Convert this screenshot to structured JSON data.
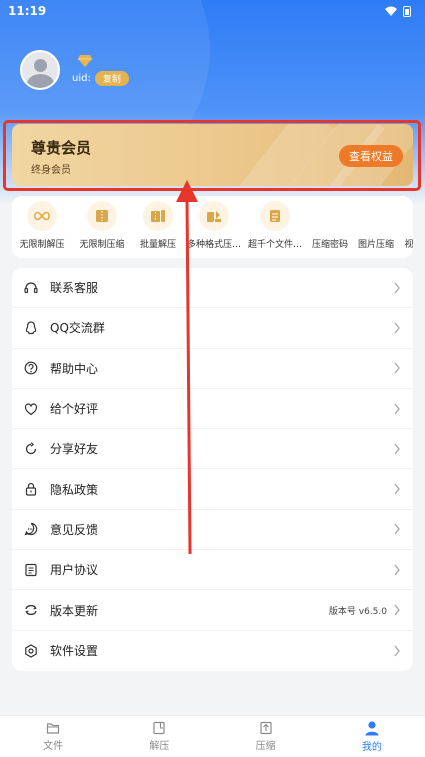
{
  "status_bar": {
    "time": "11:19"
  },
  "profile": {
    "uid_label": "uid:",
    "copy_label": "复制"
  },
  "member_card": {
    "title": "尊贵会员",
    "subtitle": "终身会员",
    "button": "查看权益"
  },
  "features": [
    {
      "label": "无限制解压",
      "icon": "infinity-icon"
    },
    {
      "label": "无限制压缩",
      "icon": "archive-icon"
    },
    {
      "label": "批量解压",
      "icon": "batch-icon"
    },
    {
      "label": "多种格式压…",
      "icon": "formats-icon"
    },
    {
      "label": "超千个文件…",
      "icon": "files-icon"
    },
    {
      "label": "压缩密码",
      "icon": ""
    },
    {
      "label": "图片压缩",
      "icon": ""
    },
    {
      "label": "视频压",
      "icon": ""
    }
  ],
  "menu": {
    "items": [
      {
        "label": "联系客服",
        "icon": "headset-icon"
      },
      {
        "label": "QQ交流群",
        "icon": "qq-icon"
      },
      {
        "label": "帮助中心",
        "icon": "help-icon"
      },
      {
        "label": "给个好评",
        "icon": "rate-icon"
      },
      {
        "label": "分享好友",
        "icon": "share-icon"
      },
      {
        "label": "隐私政策",
        "icon": "lock-icon"
      },
      {
        "label": "意见反馈",
        "icon": "feedback-icon"
      },
      {
        "label": "用户协议",
        "icon": "document-icon"
      },
      {
        "label": "版本更新",
        "icon": "refresh-icon",
        "extra": "版本号 v6.5.0"
      },
      {
        "label": "软件设置",
        "icon": "settings-icon"
      }
    ]
  },
  "tabbar": {
    "tabs": [
      {
        "label": "文件",
        "icon": "folder-icon"
      },
      {
        "label": "解压",
        "icon": "unzip-icon"
      },
      {
        "label": "压缩",
        "icon": "zip-icon"
      },
      {
        "label": "我的",
        "icon": "user-icon"
      }
    ],
    "active_index": 3
  },
  "colors": {
    "accent": "#2f7ef6",
    "gold": "#ebc68a",
    "highlight": "#e8352b",
    "button_orange": "#ee7a27"
  }
}
